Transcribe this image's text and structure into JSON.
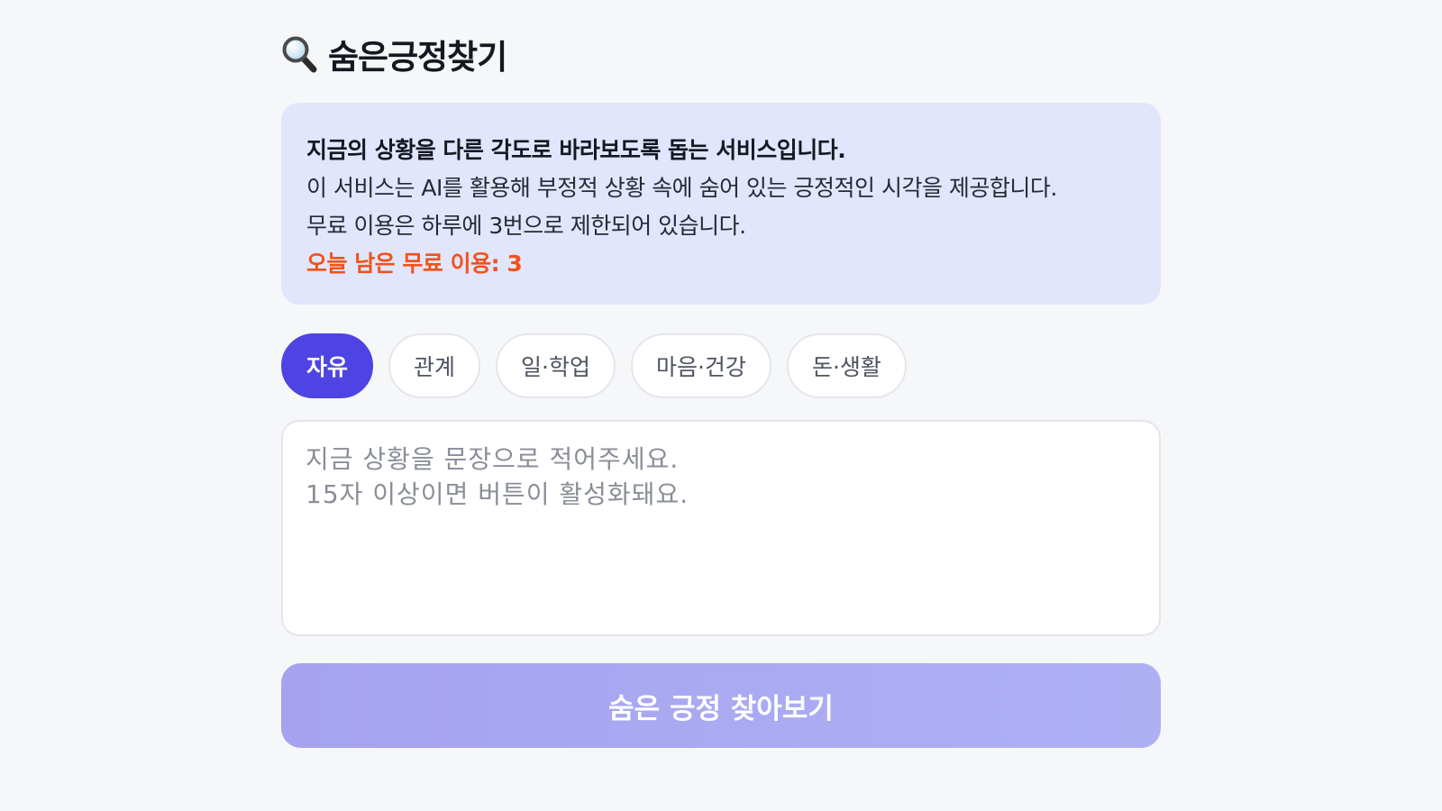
{
  "header": {
    "icon": "search-icon",
    "title": "숨은긍정찾기"
  },
  "info": {
    "headline": "지금의 상황을 다른 각도로 바라보도록 돕는 서비스입니다.",
    "line1": "이 서비스는 AI를 활용해 부정적 상황 속에 숨어 있는 긍정적인 시각을 제공합니다.",
    "line2": "무료 이용은 하루에 3번으로 제한되어 있습니다.",
    "remaining": "오늘 남은 무료 이용: 3"
  },
  "tabs": [
    {
      "label": "자유",
      "active": true
    },
    {
      "label": "관계",
      "active": false
    },
    {
      "label": "일·학업",
      "active": false
    },
    {
      "label": "마음·건강",
      "active": false
    },
    {
      "label": "돈·생활",
      "active": false
    }
  ],
  "input": {
    "value": "",
    "placeholder": "지금 상황을 문장으로 적어주세요.\n15자 이상이면 버튼이 활성화돼요."
  },
  "submit": {
    "label": "숨은 긍정 찾아보기",
    "enabled": false
  },
  "colors": {
    "accent": "#4d44e3",
    "info_background": "#e1e6fd",
    "remaining_text": "#f2521b",
    "disabled_button": "#a6a2ef"
  }
}
